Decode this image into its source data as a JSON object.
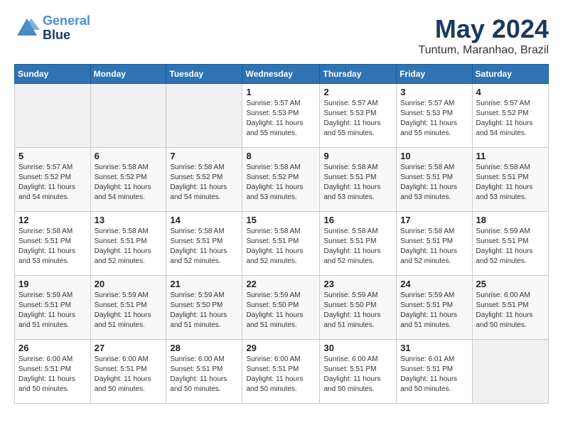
{
  "header": {
    "logo_line1": "General",
    "logo_line2": "Blue",
    "month": "May 2024",
    "location": "Tuntum, Maranhao, Brazil"
  },
  "weekdays": [
    "Sunday",
    "Monday",
    "Tuesday",
    "Wednesday",
    "Thursday",
    "Friday",
    "Saturday"
  ],
  "weeks": [
    [
      {
        "day": "",
        "info": ""
      },
      {
        "day": "",
        "info": ""
      },
      {
        "day": "",
        "info": ""
      },
      {
        "day": "1",
        "info": "Sunrise: 5:57 AM\nSunset: 5:53 PM\nDaylight: 11 hours\nand 55 minutes."
      },
      {
        "day": "2",
        "info": "Sunrise: 5:57 AM\nSunset: 5:53 PM\nDaylight: 11 hours\nand 55 minutes."
      },
      {
        "day": "3",
        "info": "Sunrise: 5:57 AM\nSunset: 5:53 PM\nDaylight: 11 hours\nand 55 minutes."
      },
      {
        "day": "4",
        "info": "Sunrise: 5:57 AM\nSunset: 5:52 PM\nDaylight: 11 hours\nand 54 minutes."
      }
    ],
    [
      {
        "day": "5",
        "info": "Sunrise: 5:57 AM\nSunset: 5:52 PM\nDaylight: 11 hours\nand 54 minutes."
      },
      {
        "day": "6",
        "info": "Sunrise: 5:58 AM\nSunset: 5:52 PM\nDaylight: 11 hours\nand 54 minutes."
      },
      {
        "day": "7",
        "info": "Sunrise: 5:58 AM\nSunset: 5:52 PM\nDaylight: 11 hours\nand 54 minutes."
      },
      {
        "day": "8",
        "info": "Sunrise: 5:58 AM\nSunset: 5:52 PM\nDaylight: 11 hours\nand 53 minutes."
      },
      {
        "day": "9",
        "info": "Sunrise: 5:58 AM\nSunset: 5:51 PM\nDaylight: 11 hours\nand 53 minutes."
      },
      {
        "day": "10",
        "info": "Sunrise: 5:58 AM\nSunset: 5:51 PM\nDaylight: 11 hours\nand 53 minutes."
      },
      {
        "day": "11",
        "info": "Sunrise: 5:58 AM\nSunset: 5:51 PM\nDaylight: 11 hours\nand 53 minutes."
      }
    ],
    [
      {
        "day": "12",
        "info": "Sunrise: 5:58 AM\nSunset: 5:51 PM\nDaylight: 11 hours\nand 53 minutes."
      },
      {
        "day": "13",
        "info": "Sunrise: 5:58 AM\nSunset: 5:51 PM\nDaylight: 11 hours\nand 52 minutes."
      },
      {
        "day": "14",
        "info": "Sunrise: 5:58 AM\nSunset: 5:51 PM\nDaylight: 11 hours\nand 52 minutes."
      },
      {
        "day": "15",
        "info": "Sunrise: 5:58 AM\nSunset: 5:51 PM\nDaylight: 11 hours\nand 52 minutes."
      },
      {
        "day": "16",
        "info": "Sunrise: 5:58 AM\nSunset: 5:51 PM\nDaylight: 11 hours\nand 52 minutes."
      },
      {
        "day": "17",
        "info": "Sunrise: 5:58 AM\nSunset: 5:51 PM\nDaylight: 11 hours\nand 52 minutes."
      },
      {
        "day": "18",
        "info": "Sunrise: 5:59 AM\nSunset: 5:51 PM\nDaylight: 11 hours\nand 52 minutes."
      }
    ],
    [
      {
        "day": "19",
        "info": "Sunrise: 5:59 AM\nSunset: 5:51 PM\nDaylight: 11 hours\nand 51 minutes."
      },
      {
        "day": "20",
        "info": "Sunrise: 5:59 AM\nSunset: 5:51 PM\nDaylight: 11 hours\nand 51 minutes."
      },
      {
        "day": "21",
        "info": "Sunrise: 5:59 AM\nSunset: 5:50 PM\nDaylight: 11 hours\nand 51 minutes."
      },
      {
        "day": "22",
        "info": "Sunrise: 5:59 AM\nSunset: 5:50 PM\nDaylight: 11 hours\nand 51 minutes."
      },
      {
        "day": "23",
        "info": "Sunrise: 5:59 AM\nSunset: 5:50 PM\nDaylight: 11 hours\nand 51 minutes."
      },
      {
        "day": "24",
        "info": "Sunrise: 5:59 AM\nSunset: 5:51 PM\nDaylight: 11 hours\nand 51 minutes."
      },
      {
        "day": "25",
        "info": "Sunrise: 6:00 AM\nSunset: 5:51 PM\nDaylight: 11 hours\nand 50 minutes."
      }
    ],
    [
      {
        "day": "26",
        "info": "Sunrise: 6:00 AM\nSunset: 5:51 PM\nDaylight: 11 hours\nand 50 minutes."
      },
      {
        "day": "27",
        "info": "Sunrise: 6:00 AM\nSunset: 5:51 PM\nDaylight: 11 hours\nand 50 minutes."
      },
      {
        "day": "28",
        "info": "Sunrise: 6:00 AM\nSunset: 5:51 PM\nDaylight: 11 hours\nand 50 minutes."
      },
      {
        "day": "29",
        "info": "Sunrise: 6:00 AM\nSunset: 5:51 PM\nDaylight: 11 hours\nand 50 minutes."
      },
      {
        "day": "30",
        "info": "Sunrise: 6:00 AM\nSunset: 5:51 PM\nDaylight: 11 hours\nand 50 minutes."
      },
      {
        "day": "31",
        "info": "Sunrise: 6:01 AM\nSunset: 5:51 PM\nDaylight: 11 hours\nand 50 minutes."
      },
      {
        "day": "",
        "info": ""
      }
    ]
  ]
}
